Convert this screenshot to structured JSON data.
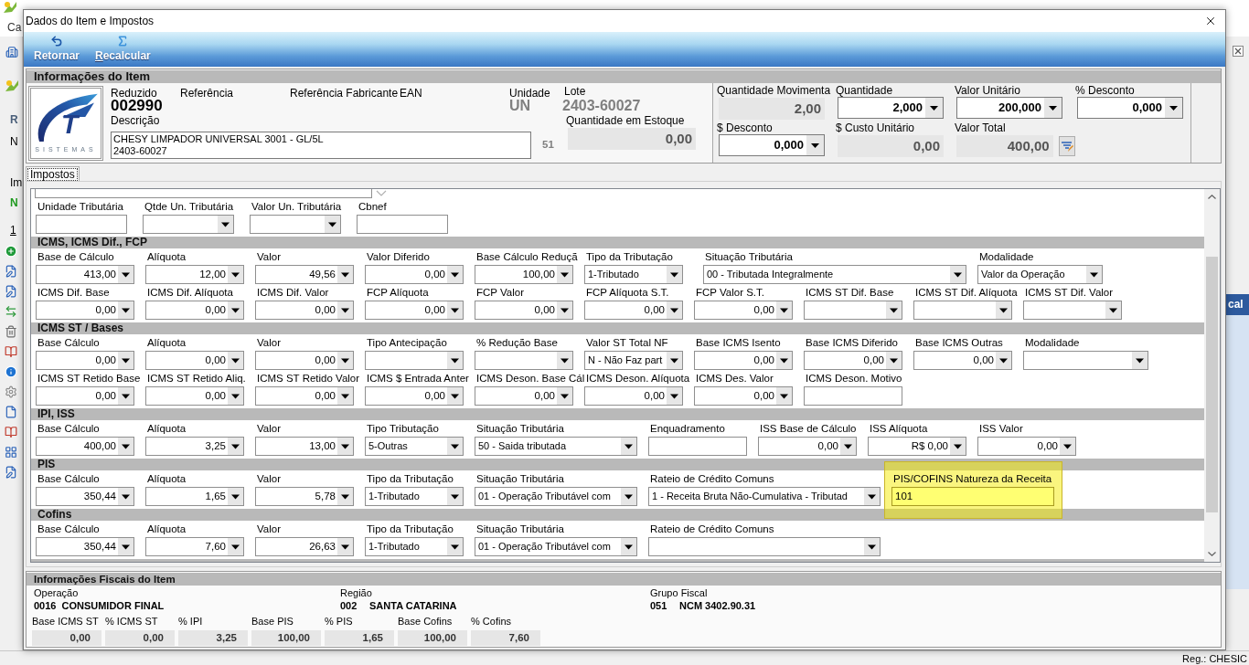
{
  "background": {
    "menu": "Ca",
    "left_texts": [
      {
        "text": "R",
        "kind": "header"
      },
      {
        "text": "N",
        "kind": "plain"
      },
      {
        "text": "Im",
        "kind": "plain"
      },
      {
        "text": "N",
        "kind": "status"
      },
      {
        "text": "1",
        "kind": "tab"
      }
    ],
    "right_header": "cal",
    "status_user": "Reg.: CHESIC"
  },
  "window": {
    "title": "Dados do Item e Impostos"
  },
  "toolbar": [
    {
      "label": "Retornar",
      "kind": "back",
      "mnemonic": false
    },
    {
      "label": "Recalcular",
      "kind": "sum",
      "mnemonic": true
    }
  ],
  "item_info": {
    "title": "Informações do Item",
    "logo": {
      "mark": "T",
      "wordmark": "SISTEMAS"
    },
    "header_labels": [
      "Reduzido",
      "Referência",
      "Referência Fabricante",
      "EAN",
      "Unidade"
    ],
    "reduzido": "002990",
    "unidade": "UN",
    "lote": {
      "label": "Lote",
      "value": "2403-60027"
    },
    "descricao": {
      "label": "Descrição",
      "lines": [
        "CHESY LIMPADOR UNIVERSAL 3001 - GL/5L",
        "2403-60027"
      ],
      "count": "51"
    },
    "estoque": {
      "label": "Quantidade em Estoque",
      "value": "0,00"
    },
    "quantities": [
      {
        "label": "Quantidade Movimenta",
        "value": "2,00",
        "kind": "readonly"
      },
      {
        "label": "Quantidade",
        "value": "2,000",
        "kind": "combo"
      },
      {
        "label": "Valor Unitário",
        "value": "200,000",
        "kind": "combo"
      },
      {
        "label": "% Desconto",
        "value": "0,000",
        "kind": "combo"
      },
      {
        "label": "$ Desconto",
        "value": "0,000",
        "kind": "combo"
      },
      {
        "label": "$ Custo Unitário",
        "value": "0,00",
        "kind": "readonly"
      },
      {
        "label": "Valor Total",
        "value": "400,00",
        "kind": "readonly_action"
      }
    ]
  },
  "tabs": [
    {
      "label": "Impostos",
      "selected": true
    }
  ],
  "tax_sections": [
    {
      "rows": [
        [
          {
            "label": "Unidade Tributária",
            "kind": "text"
          },
          {
            "label": "Qtde Un. Tributária",
            "kind": "number"
          },
          {
            "label": "Valor Un. Tributária",
            "kind": "number"
          },
          {
            "label": "Cbnef",
            "kind": "text"
          }
        ]
      ]
    },
    {
      "title": "ICMS, ICMS Dif., FCP",
      "rows": [
        [
          {
            "label": "Base de Cálculo",
            "value": "413,00",
            "kind": "number"
          },
          {
            "label": "Alíquota",
            "value": "12,00",
            "kind": "number"
          },
          {
            "label": "Valor",
            "value": "49,56",
            "kind": "number"
          },
          {
            "label": "Valor Diferido",
            "value": "0,00",
            "kind": "number"
          },
          {
            "label": "Base Cálculo Reduçã",
            "value": "100,00",
            "kind": "number"
          },
          {
            "label": "Tipo da Tributação",
            "value": "1-Tributado",
            "kind": "select"
          },
          {
            "label": "Situação Tributária",
            "value": "00 - Tributada Integralmente",
            "kind": "select_xlong"
          },
          {
            "label": "Modalidade",
            "value": "Valor da Operação",
            "kind": "select_mid"
          }
        ],
        [
          {
            "label": "ICMS Dif. Base",
            "value": "0,00",
            "kind": "number"
          },
          {
            "label": "ICMS Dif. Alíquota",
            "value": "0,00",
            "kind": "number"
          },
          {
            "label": "ICMS Dif. Valor",
            "value": "0,00",
            "kind": "number"
          },
          {
            "label": "FCP Alíquota",
            "value": "0,00",
            "kind": "number"
          },
          {
            "label": "FCP Valor",
            "value": "0,00",
            "kind": "number"
          },
          {
            "label": "FCP Alíquota S.T.",
            "value": "0,00",
            "kind": "number"
          },
          {
            "label": "FCP Valor S.T.",
            "value": "0,00",
            "kind": "number"
          },
          {
            "label": "ICMS ST Dif. Base",
            "kind": "number"
          },
          {
            "label": "ICMS ST Dif. Alíquota",
            "kind": "number"
          },
          {
            "label": "ICMS ST Dif. Valor",
            "kind": "number"
          }
        ]
      ]
    },
    {
      "title": "ICMS ST / Bases",
      "rows": [
        [
          {
            "label": "Base Cálculo",
            "value": "0,00",
            "kind": "number"
          },
          {
            "label": "Alíquota",
            "value": "0,00",
            "kind": "number"
          },
          {
            "label": "Valor",
            "value": "0,00",
            "kind": "number"
          },
          {
            "label": "Tipo Antecipação",
            "kind": "select"
          },
          {
            "label": "% Redução Base",
            "kind": "select"
          },
          {
            "label": "Valor ST Total NF",
            "value": "N - Não Faz part",
            "kind": "select"
          },
          {
            "label": "Base ICMS Isento",
            "value": "0,00",
            "kind": "number"
          },
          {
            "label": "Base ICMS Diferido",
            "value": "0,00",
            "kind": "number"
          },
          {
            "label": "Base ICMS Outras",
            "value": "0,00",
            "kind": "number"
          },
          {
            "label": "Modalidade",
            "kind": "select_mid"
          }
        ],
        [
          {
            "label": "ICMS ST Retido Base",
            "value": "0,00",
            "kind": "number"
          },
          {
            "label": "ICMS ST Retido Aliq.",
            "value": "0,00",
            "kind": "number"
          },
          {
            "label": "ICMS ST Retido Valor",
            "value": "0,00",
            "kind": "number"
          },
          {
            "label": "ICMS $ Entrada Anter",
            "value": "0,00",
            "kind": "number"
          },
          {
            "label": "ICMS Deson. Base Cál",
            "value": "0,00",
            "kind": "number"
          },
          {
            "label": "ICMS Deson. Alíquota",
            "value": "0,00",
            "kind": "number"
          },
          {
            "label": "ICMS Des. Valor",
            "value": "0,00",
            "kind": "number"
          },
          {
            "label": "ICMS Deson. Motivo",
            "kind": "text"
          }
        ]
      ]
    },
    {
      "title": "IPI, ISS",
      "rows": [
        [
          {
            "label": "Base Cálculo",
            "value": "400,00",
            "kind": "number"
          },
          {
            "label": "Alíquota",
            "value": "3,25",
            "kind": "number"
          },
          {
            "label": "Valor",
            "value": "13,00",
            "kind": "number"
          },
          {
            "label": "Tipo Tributação",
            "value": "5-Outras",
            "kind": "select"
          },
          {
            "label": "Situação Tributária",
            "value": "50 - Saida tributada",
            "kind": "select_wide"
          },
          {
            "label": "Enquadramento",
            "kind": "text"
          },
          {
            "label": "ISS Base de Cálculo",
            "value": "0,00",
            "kind": "number"
          },
          {
            "label": "ISS Alíquota",
            "value": "R$ 0,00",
            "kind": "number"
          },
          {
            "label": "ISS Valor",
            "value": "0,00",
            "kind": "number"
          }
        ]
      ]
    },
    {
      "title": "PIS",
      "rows": [
        [
          {
            "label": "Base Cálculo",
            "value": "350,44",
            "kind": "number",
            "highlighted": false
          },
          {
            "label": "Alíquota",
            "value": "1,65",
            "kind": "number",
            "highlighted": false
          },
          {
            "label": "Valor",
            "value": "5,78",
            "kind": "number",
            "highlighted": false
          },
          {
            "label": "Tipo da Tributação",
            "value": "1-Tributado",
            "kind": "select",
            "highlighted": false
          },
          {
            "label": "Situação Tributária",
            "value": "01 - Operação Tributável com",
            "kind": "select_wide",
            "highlighted": false
          },
          {
            "label": "Rateio de Crédito Comuns",
            "value": "1 - Receita Bruta Não-Cumulativa - Tributad",
            "kind": "select_long",
            "highlighted": false
          },
          {
            "label": "PIS/COFINS Natureza da Receita",
            "value": "101",
            "kind": "text_wide",
            "highlighted": true
          }
        ]
      ]
    },
    {
      "title": "Cofins",
      "rows": [
        [
          {
            "label": "Base Cálculo",
            "value": "350,44",
            "kind": "number"
          },
          {
            "label": "Alíquota",
            "value": "7,60",
            "kind": "number"
          },
          {
            "label": "Valor",
            "value": "26,63",
            "kind": "number"
          },
          {
            "label": "Tipo da Tributação",
            "value": "1-Tributado",
            "kind": "select"
          },
          {
            "label": "Situação Tributária",
            "value": "01 - Operação Tributável com",
            "kind": "select_wide"
          },
          {
            "label": "Rateio de Crédito Comuns",
            "kind": "select_long"
          }
        ]
      ]
    }
  ],
  "fiscal_info": {
    "title": "Informações Fiscais do Item",
    "groups": [
      {
        "label": "Operação",
        "code": "0016",
        "value": "CONSUMIDOR FINAL"
      },
      {
        "label": "Região",
        "code": "002",
        "value": "SANTA CATARINA"
      },
      {
        "label": "Grupo Fiscal",
        "code": "051",
        "value": "NCM 3402.90.31"
      }
    ],
    "totals": [
      {
        "label": "Base ICMS ST",
        "value": "0,00"
      },
      {
        "label": "% ICMS ST",
        "value": "0,00"
      },
      {
        "label": "% IPI",
        "value": "3,25"
      },
      {
        "label": "Base PIS",
        "value": "100,00"
      },
      {
        "label": "% PIS",
        "value": "1,65"
      },
      {
        "label": "Base Cofins",
        "value": "100,00"
      },
      {
        "label": "% Cofins",
        "value": "7,60"
      }
    ]
  }
}
